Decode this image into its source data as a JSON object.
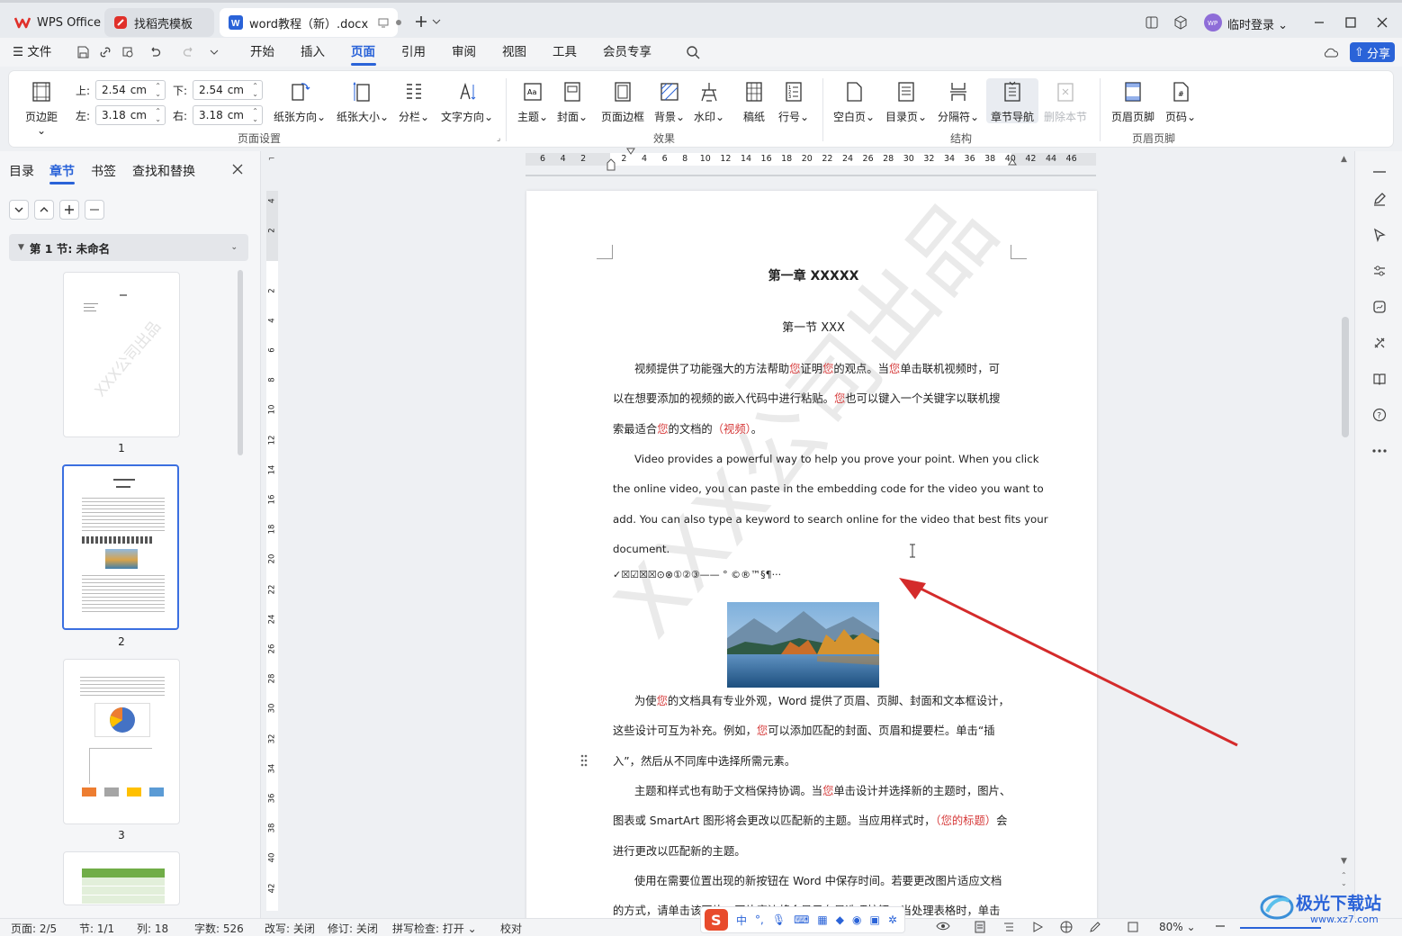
{
  "tabs": [
    {
      "label": "WPS Office"
    },
    {
      "label": "找稻壳模板"
    },
    {
      "label": "word教程（新）.docx"
    }
  ],
  "window": {
    "user_label": "临时登录",
    "avatar_text": "WP"
  },
  "menu": {
    "file": "文件",
    "items": [
      "开始",
      "插入",
      "页面",
      "引用",
      "审阅",
      "视图",
      "工具",
      "会员专享"
    ],
    "active": "页面",
    "share": "分享"
  },
  "ribbon": {
    "margins": {
      "label": "页边距",
      "top_label": "上:",
      "top": "2.54",
      "bottom_label": "下:",
      "bottom": "2.54",
      "left_label": "左:",
      "left": "3.18",
      "right_label": "右:",
      "right": "3.18",
      "unit": "cm"
    },
    "page_setup": [
      "纸张方向",
      "纸张大小",
      "分栏",
      "文字方向"
    ],
    "page_setup_group": "页面设置",
    "effects": [
      "主题",
      "封面",
      "页面边框",
      "背景",
      "水印",
      "稿纸",
      "行号"
    ],
    "effects_group": "效果",
    "structure": [
      "空白页",
      "目录页",
      "分隔符",
      "章节导航",
      "删除本节"
    ],
    "structure_group": "结构",
    "header_footer": [
      "页眉页脚",
      "页码"
    ],
    "header_footer_group": "页眉页脚"
  },
  "nav": {
    "tabs": [
      "目录",
      "章节",
      "书签",
      "查找和替换"
    ],
    "active": "章节",
    "section": "第 1 节: 未命名",
    "thumbs": [
      "1",
      "2",
      "3"
    ],
    "thumb1_watermark": "XXX公司出品"
  },
  "ruler": {
    "h": [
      "6",
      "4",
      "2",
      "",
      "2",
      "4",
      "6",
      "8",
      "10",
      "12",
      "14",
      "16",
      "18",
      "20",
      "22",
      "24",
      "26",
      "28",
      "30",
      "32",
      "34",
      "36",
      "38",
      "40",
      "42",
      "44",
      "46"
    ],
    "v": [
      "4",
      "2",
      "",
      "2",
      "4",
      "6",
      "8",
      "10",
      "12",
      "14",
      "16",
      "18",
      "20",
      "22",
      "24",
      "26",
      "28",
      "30",
      "32",
      "34",
      "36",
      "38",
      "40",
      "42"
    ]
  },
  "document": {
    "chapter": "第一章  XXXXX",
    "section": "第一节  XXX",
    "p1": [
      "视频提供了功能强大的方法帮助",
      "您",
      "证明",
      "您",
      "的观点。当",
      "您",
      "单击联机视频时，可",
      "以在想要添加的视频的嵌入代码中进行粘贴。",
      "您",
      "也可以键入一个关键字以联机搜",
      "索最适合",
      "您",
      "的文档的",
      "（视频）",
      "。"
    ],
    "p2_lines": [
      "Video provides a powerful way to help you prove your point. When you click",
      "the online video, you can paste in the embedding code for the video you want to",
      "add. You can also type a keyword to search online for the video that best fits your",
      "document."
    ],
    "symbols": "✓☒☑☒☒⊙⊗①②③——    °  ©®™§¶···",
    "p3": [
      "为使",
      "您",
      "的文档具有专业外观，Word  提供了页眉、页脚、封面和文本框设计，",
      "这些设计可互为补充。例如，",
      "您",
      "可以添加匹配的封面、页眉和提要栏。单击“插",
      "入”，然后从不同库中选择所需元素。"
    ],
    "p4": [
      "主题和样式也有助于文档保持协调。当",
      "您",
      "单击设计并选择新的主题时，图片、",
      "图表或  SmartArt  图形将会更改以匹配新的主题。当应用样式时，",
      "（您的标题）",
      "会",
      "进行更改以匹配新的主题。"
    ],
    "p5_lines": [
      "使用在需要位置出现的新按钮在  Word  中保存时间。若要更改图片适应文档",
      "的方式，请单击该图片，图片旁边将会显示布局选项按钮。当处理表格时，单击"
    ],
    "watermark": "XXX公司出品"
  },
  "status": {
    "page": "页面: 2/5",
    "section": "节: 1/1",
    "column": "列: 18",
    "words": "字数: 526",
    "overwrite": "改写: 关闭",
    "revision": "修订: 关闭",
    "spellcheck": "拼写检查: 打开",
    "proof": "校对",
    "zoom": "80%",
    "ime": "中"
  },
  "corner_logo": {
    "text": "极光下载站",
    "url": "www.xz7.com"
  },
  "colors": {
    "accent": "#2a63d8",
    "arrow": "#d42b2b",
    "highlight_text": "#d63a3a"
  }
}
